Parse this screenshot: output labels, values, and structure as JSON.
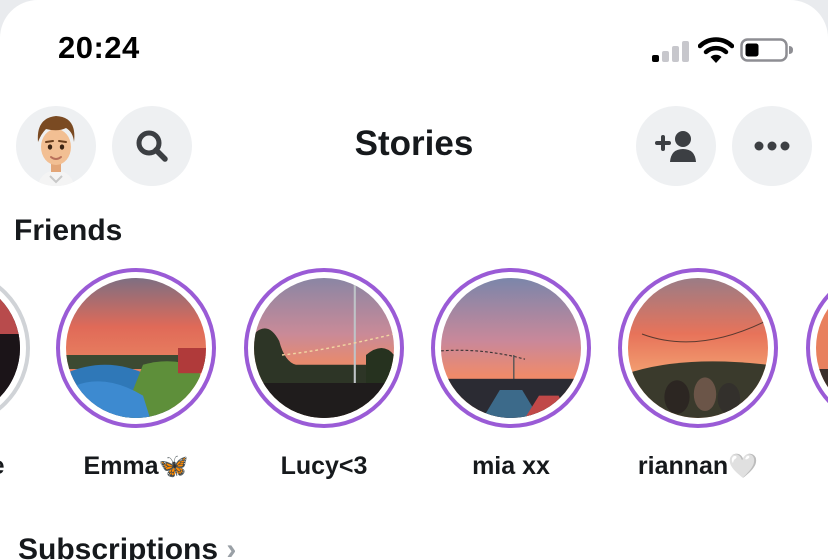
{
  "status_bar": {
    "time": "20:24"
  },
  "header": {
    "title": "Stories"
  },
  "friends": {
    "section_label": "Friends",
    "stories": [
      {
        "name": "ne",
        "emoji": ""
      },
      {
        "name": "Emma",
        "emoji": "🦋"
      },
      {
        "name": "Lucy<3",
        "emoji": ""
      },
      {
        "name": "mia xx",
        "emoji": ""
      },
      {
        "name": "riannan",
        "emoji": "🤍"
      }
    ]
  },
  "subscriptions": {
    "section_label": "Subscriptions",
    "chevron": "›"
  },
  "colors": {
    "story_ring": "#9a5bd6",
    "icon_bg": "#eef0f2",
    "text": "#16191c"
  }
}
